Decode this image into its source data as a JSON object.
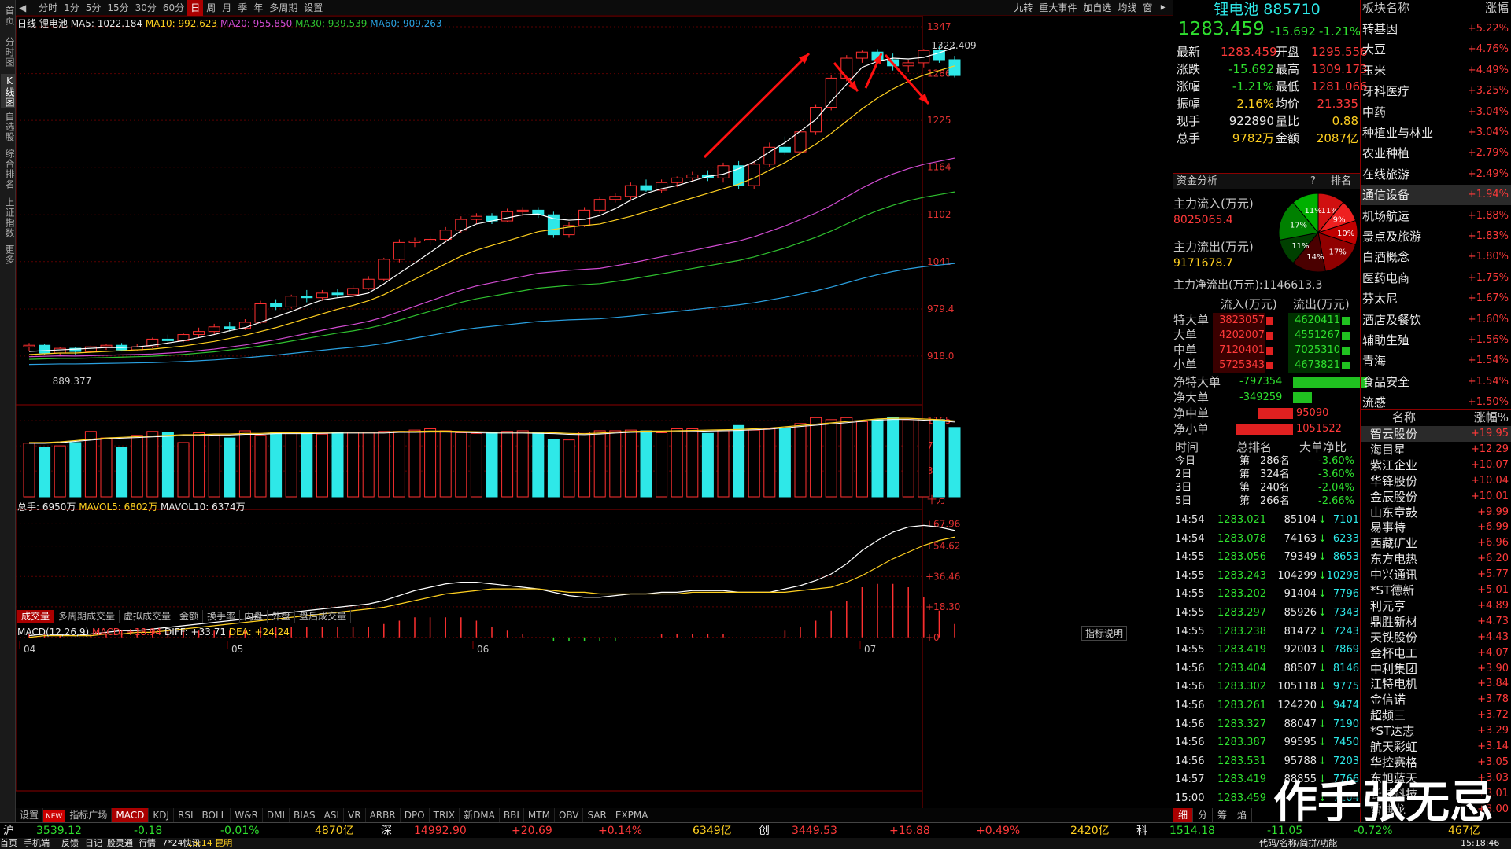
{
  "leftnav": [
    "首页",
    "分时图",
    "K线图",
    "自选股",
    "综合排名",
    "上证指数",
    "更多"
  ],
  "topbar": {
    "periods": [
      "分时",
      "1分",
      "5分",
      "15分",
      "30分",
      "60分",
      "日",
      "周",
      "月",
      "季",
      "年",
      "多周期",
      "设置"
    ],
    "active": "日",
    "right": [
      "九转",
      "重大事件",
      "加自选",
      "均线",
      "窗",
      "⯈"
    ]
  },
  "kline": {
    "label": "日线",
    "name": "锂电池",
    "ma5": "MA5: 1022.184",
    "ma10": "MA10: 992.623",
    "ma20": "MA20: 955.850",
    "ma30": "MA30: 939.539",
    "ma60": "MA60: 909.263",
    "hi_label": "1322.409",
    "lo_label": "889.377",
    "yticks": [
      "1347",
      "1286",
      "1225",
      "1164",
      "1102",
      "1041",
      "979.4",
      "918.0"
    ]
  },
  "volume": {
    "label": "总手: 6950万",
    "mavol5": "MAVOL5: 6802万",
    "mavol10": "MAVOL10: 6374万",
    "yticks": [
      "1165",
      "780",
      "395",
      "十万"
    ],
    "tabs": [
      "成交量",
      "多周期成交量",
      "虚拟成交量",
      "金额",
      "换手率",
      "内盘",
      "外盘",
      "盘后成交量"
    ]
  },
  "macd": {
    "label": "MACD(12,26,9)",
    "macd": "MACD: +18.94",
    "diff": "DIFF: +33.71",
    "dea": "DEA: +24.24",
    "btn": "指标说明",
    "yticks": [
      "+67.96",
      "+54.62",
      "+36.46",
      "+18.30",
      "+0"
    ]
  },
  "xaxis": [
    "04",
    "05",
    "06",
    "07"
  ],
  "bottomtabs": [
    "设置",
    "NEW",
    "指标广场",
    "MACD",
    "KDJ",
    "RSI",
    "BOLL",
    "W&R",
    "DMI",
    "BIAS",
    "ASI",
    "VR",
    "ARBR",
    "DPO",
    "TRIX",
    "新DMA",
    "BBI",
    "MTM",
    "OBV",
    "SAR",
    "EXPMA"
  ],
  "quote": {
    "title": "锂电池 885710",
    "price": "1283.459",
    "chg": "-15.692",
    "pct": "-1.21%",
    "rows": [
      [
        "最新",
        "1283.459",
        "开盘",
        "1295.556"
      ],
      [
        "涨跌",
        "-15.692",
        "最高",
        "1309.173"
      ],
      [
        "涨幅",
        "-1.21%",
        "最低",
        "1281.066"
      ],
      [
        "振幅",
        "2.16%",
        "均价",
        "21.335"
      ],
      [
        "现手",
        "922890",
        "量比",
        "0.88"
      ],
      [
        "总手",
        "9782万",
        "金额",
        "2087亿"
      ]
    ]
  },
  "fund": {
    "title": "资金分析",
    "q": "?",
    "rank": "排名",
    "in_label": "主力流入(万元)",
    "in_val": "8025065.4",
    "out_label": "主力流出(万元)",
    "out_val": "9171678.7",
    "net": "主力净流出(万元):1146613.3",
    "pie": [
      "11%",
      "9%",
      "10%",
      "17%",
      "14%",
      "11%",
      "17%",
      "11%"
    ],
    "head": [
      "流入(万元)",
      "流出(万元)"
    ],
    "rows": [
      [
        "特大单",
        "3823057",
        "4620411"
      ],
      [
        "大单",
        "4202007",
        "4551267"
      ],
      [
        "中单",
        "7120401",
        "7025310"
      ],
      [
        "小单",
        "5725343",
        "4673821"
      ]
    ],
    "net_rows": [
      [
        "净特大单",
        "-797354"
      ],
      [
        "净大单",
        "-349259"
      ],
      [
        "净中单",
        "95090"
      ],
      [
        "净小单",
        "1051522"
      ]
    ]
  },
  "rankt": {
    "head": [
      "时间",
      "总排名",
      "大单净比"
    ],
    "rows": [
      [
        "今日",
        "第",
        "286名",
        "-3.60%"
      ],
      [
        "2日",
        "第",
        "324名",
        "-3.60%"
      ],
      [
        "3日",
        "第",
        "240名",
        "-2.04%"
      ],
      [
        "5日",
        "第",
        "266名",
        "-2.66%"
      ]
    ]
  },
  "ticks": [
    [
      "14:54",
      "1283.021",
      "85104",
      "7101"
    ],
    [
      "14:54",
      "1283.078",
      "74163",
      "6233"
    ],
    [
      "14:55",
      "1283.056",
      "79349",
      "8653"
    ],
    [
      "14:55",
      "1283.243",
      "104299",
      "10298"
    ],
    [
      "14:55",
      "1283.202",
      "91404",
      "7796"
    ],
    [
      "14:55",
      "1283.297",
      "85926",
      "7343"
    ],
    [
      "14:55",
      "1283.238",
      "81472",
      "7243"
    ],
    [
      "14:55",
      "1283.419",
      "92003",
      "7869"
    ],
    [
      "14:56",
      "1283.404",
      "88507",
      "8146"
    ],
    [
      "14:56",
      "1283.302",
      "105118",
      "9775"
    ],
    [
      "14:56",
      "1283.261",
      "124220",
      "9474"
    ],
    [
      "14:56",
      "1283.327",
      "88047",
      "7190"
    ],
    [
      "14:56",
      "1283.387",
      "99595",
      "7450"
    ],
    [
      "14:56",
      "1283.531",
      "95788",
      "7203"
    ],
    [
      "14:57",
      "1283.419",
      "88855",
      "7766"
    ],
    [
      "15:00",
      "1283.459",
      "",
      "7104"
    ]
  ],
  "tickTabs": [
    "细",
    "分",
    "筹",
    "焰"
  ],
  "sectors": {
    "head": [
      "板块名称",
      "涨幅"
    ],
    "rows": [
      [
        "转基因",
        "+5.22%"
      ],
      [
        "大豆",
        "+4.76%"
      ],
      [
        "玉米",
        "+4.49%"
      ],
      [
        "牙科医疗",
        "+3.25%"
      ],
      [
        "中药",
        "+3.04%"
      ],
      [
        "种植业与林业",
        "+3.04%"
      ],
      [
        "农业种植",
        "+2.79%"
      ],
      [
        "在线旅游",
        "+2.49%"
      ],
      [
        "通信设备",
        "+1.94%"
      ],
      [
        "机场航运",
        "+1.88%"
      ],
      [
        "景点及旅游",
        "+1.83%"
      ],
      [
        "白酒概念",
        "+1.80%"
      ],
      [
        "医药电商",
        "+1.75%"
      ],
      [
        "芬太尼",
        "+1.67%"
      ],
      [
        "酒店及餐饮",
        "+1.60%"
      ],
      [
        "辅助生殖",
        "+1.56%"
      ],
      [
        "青海",
        "+1.54%"
      ],
      [
        "食品安全",
        "+1.54%"
      ],
      [
        "流感",
        "+1.50%"
      ]
    ]
  },
  "stocks": {
    "head": [
      "名称",
      "涨幅%"
    ],
    "rows": [
      [
        "智云股份",
        "+19.95"
      ],
      [
        "海目星",
        "+12.29"
      ],
      [
        "紫江企业",
        "+10.07"
      ],
      [
        "华锋股份",
        "+10.04"
      ],
      [
        "金辰股份",
        "+10.01"
      ],
      [
        "山东章鼓",
        "+9.99"
      ],
      [
        "易事特",
        "+6.99"
      ],
      [
        "西藏矿业",
        "+6.96"
      ],
      [
        "东方电热",
        "+6.20"
      ],
      [
        "中兴通讯",
        "+5.77"
      ],
      [
        "*ST德新",
        "+5.01"
      ],
      [
        "利元亨",
        "+4.89"
      ],
      [
        "鼎胜新材",
        "+4.73"
      ],
      [
        "天铁股份",
        "+4.43"
      ],
      [
        "金杯电工",
        "+4.07"
      ],
      [
        "中利集团",
        "+3.90"
      ],
      [
        "江特电机",
        "+3.84"
      ],
      [
        "金信诺",
        "+3.78"
      ],
      [
        "超频三",
        "+3.72"
      ],
      [
        "*ST达志",
        "+3.29"
      ],
      [
        "航天彩虹",
        "+3.14"
      ],
      [
        "华控赛格",
        "+3.05"
      ],
      [
        "东旭蓝天",
        "+3.03"
      ],
      [
        "长城科技",
        "+3.01"
      ],
      [
        "雪迪龙",
        "+3.00"
      ]
    ]
  },
  "status": {
    "sh": [
      "沪",
      "3539.12",
      "-0.18",
      "-0.01%",
      "4870亿"
    ],
    "sz": [
      "深",
      "14992.90",
      "+20.69",
      "+0.14%",
      "6349亿"
    ],
    "cy": [
      "创",
      "3449.53",
      "+16.88",
      "+0.49%",
      "2420亿"
    ],
    "kc": [
      "科",
      "1514.18",
      "-11.05",
      "-0.72%",
      "467亿"
    ]
  },
  "status2": [
    "首页",
    "手机端",
    "反馈",
    "日记",
    "股灵通",
    "行情",
    "7*24快讯",
    "15:14 昆明",
    "代码/名称/简拼/功能",
    "15:18:46"
  ],
  "watermark": "作手张无忌",
  "colors": {
    "up": "#ff3030",
    "down": "#2ee8e8",
    "ma5": "#ffffff",
    "ma10": "#ffd020",
    "ma20": "#d24cd2",
    "ma30": "#2fc02f",
    "ma60": "#2aa0e0"
  },
  "chart_data": [
    {
      "type": "candlestick",
      "title": "锂电池 日线",
      "ylim": [
        889.377,
        1347
      ],
      "candles": [
        [
          930,
          935,
          925,
          932
        ],
        [
          932,
          934,
          920,
          922
        ],
        [
          922,
          930,
          918,
          928
        ],
        [
          928,
          930,
          920,
          924
        ],
        [
          924,
          932,
          922,
          930
        ],
        [
          930,
          934,
          926,
          932
        ],
        [
          932,
          935,
          924,
          926
        ],
        [
          926,
          934,
          925,
          930
        ],
        [
          930,
          942,
          928,
          940
        ],
        [
          940,
          946,
          934,
          938
        ],
        [
          938,
          948,
          936,
          946
        ],
        [
          946,
          955,
          942,
          950
        ],
        [
          950,
          960,
          946,
          956
        ],
        [
          956,
          962,
          950,
          954
        ],
        [
          954,
          966,
          952,
          962
        ],
        [
          962,
          990,
          960,
          986
        ],
        [
          986,
          992,
          978,
          982
        ],
        [
          982,
          998,
          980,
          996
        ],
        [
          996,
          1004,
          988,
          994
        ],
        [
          994,
          1004,
          990,
          1000
        ],
        [
          1000,
          1006,
          994,
          998
        ],
        [
          998,
          1010,
          994,
          1006
        ],
        [
          1006,
          1022,
          1004,
          1018
        ],
        [
          1018,
          1046,
          1016,
          1044
        ],
        [
          1044,
          1070,
          1040,
          1066
        ],
        [
          1066,
          1072,
          1060,
          1068
        ],
        [
          1068,
          1074,
          1062,
          1070
        ],
        [
          1070,
          1086,
          1066,
          1082
        ],
        [
          1082,
          1100,
          1078,
          1096
        ],
        [
          1096,
          1104,
          1090,
          1100
        ],
        [
          1100,
          1104,
          1090,
          1094
        ],
        [
          1094,
          1110,
          1092,
          1106
        ],
        [
          1106,
          1112,
          1100,
          1108
        ],
        [
          1108,
          1112,
          1098,
          1102
        ],
        [
          1102,
          1106,
          1072,
          1076
        ],
        [
          1076,
          1092,
          1072,
          1088
        ],
        [
          1088,
          1112,
          1086,
          1108
        ],
        [
          1108,
          1126,
          1104,
          1122
        ],
        [
          1122,
          1130,
          1118,
          1126
        ],
        [
          1126,
          1144,
          1122,
          1140
        ],
        [
          1140,
          1148,
          1132,
          1134
        ],
        [
          1134,
          1148,
          1130,
          1144
        ],
        [
          1144,
          1152,
          1138,
          1150
        ],
        [
          1150,
          1158,
          1146,
          1154
        ],
        [
          1154,
          1160,
          1146,
          1150
        ],
        [
          1150,
          1170,
          1144,
          1166
        ],
        [
          1166,
          1172,
          1136,
          1140
        ],
        [
          1140,
          1172,
          1136,
          1168
        ],
        [
          1168,
          1196,
          1164,
          1190
        ],
        [
          1190,
          1204,
          1180,
          1184
        ],
        [
          1184,
          1212,
          1182,
          1210
        ],
        [
          1210,
          1246,
          1206,
          1242
        ],
        [
          1242,
          1284,
          1238,
          1280
        ],
        [
          1280,
          1310,
          1276,
          1306
        ],
        [
          1306,
          1316,
          1300,
          1314
        ],
        [
          1314,
          1318,
          1300,
          1304
        ],
        [
          1304,
          1312,
          1290,
          1296
        ],
        [
          1296,
          1304,
          1288,
          1300
        ],
        [
          1300,
          1318,
          1294,
          1316
        ],
        [
          1316,
          1322.409,
          1300,
          1304
        ],
        [
          1304,
          1309,
          1281,
          1283.459
        ]
      ],
      "ma_lines": {
        "MA5": [
          924,
          925,
          926,
          927,
          928,
          929,
          929,
          930,
          932,
          935,
          938,
          942,
          946,
          951,
          955,
          962,
          969,
          976,
          984,
          991,
          994,
          996,
          1000,
          1012,
          1026,
          1039,
          1053,
          1067,
          1081,
          1090,
          1094,
          1098,
          1102,
          1103,
          1097,
          1095,
          1096,
          1101,
          1110,
          1121,
          1130,
          1136,
          1140,
          1146,
          1152,
          1155,
          1162,
          1171,
          1184,
          1196,
          1211,
          1226,
          1250,
          1272,
          1294,
          1302,
          1306,
          1305,
          1307,
          1313,
          1320
        ],
        "MA10": [
          920,
          921,
          922,
          922,
          923,
          924,
          925,
          926,
          927,
          929,
          931,
          934,
          937,
          941,
          945,
          950,
          955,
          961,
          967,
          973,
          979,
          984,
          990,
          998,
          1008,
          1018,
          1028,
          1038,
          1048,
          1056,
          1062,
          1068,
          1074,
          1080,
          1083,
          1086,
          1088,
          1090,
          1095,
          1100,
          1106,
          1112,
          1118,
          1124,
          1130,
          1136,
          1142,
          1150,
          1160,
          1170,
          1182,
          1194,
          1208,
          1224,
          1240,
          1254,
          1266,
          1276,
          1284,
          1290,
          1296
        ]
      },
      "note": "red arrows drawn as annotations"
    },
    {
      "type": "bar",
      "title": "成交量",
      "unit": "十万",
      "ylim": [
        0,
        1165
      ],
      "values": [
        820,
        760,
        780,
        830,
        1000,
        900,
        760,
        940,
        1000,
        980,
        830,
        980,
        940,
        900,
        1010,
        940,
        990,
        980,
        990,
        960,
        990,
        990,
        990,
        1000,
        1000,
        1020,
        1040,
        1010,
        980,
        970,
        980,
        1000,
        1010,
        990,
        880,
        870,
        990,
        1010,
        1010,
        1020,
        1010,
        980,
        1040,
        1040,
        970,
        1010,
        1090,
        1020,
        1040,
        1050,
        1120,
        1210,
        1180,
        1210,
        1150,
        1180,
        1220,
        1180,
        1190,
        1180,
        1060
      ],
      "mavol5": [
        830,
        830,
        840,
        860,
        880,
        900,
        910,
        920,
        930,
        940,
        950,
        950,
        960,
        960,
        970,
        970,
        980,
        980,
        980,
        985,
        990,
        990,
        990,
        990,
        1000,
        1000,
        1005,
        1005,
        1000,
        995,
        990,
        990,
        990,
        985,
        980,
        970,
        965,
        975,
        990,
        1000,
        1005,
        1005,
        1010,
        1015,
        1020,
        1025,
        1030,
        1040,
        1050,
        1070,
        1090,
        1110,
        1130,
        1150,
        1170,
        1190,
        1200,
        1200,
        1190,
        1180,
        1160
      ]
    },
    {
      "type": "line",
      "title": "MACD(12,26,9)",
      "ylim": [
        -5,
        67.96
      ],
      "diff": [
        1,
        2,
        1.5,
        1,
        2,
        3,
        4,
        4,
        5,
        6,
        7,
        8,
        9,
        10,
        11,
        13,
        14,
        15,
        16,
        17,
        18,
        19,
        20,
        22,
        25,
        28,
        30,
        32,
        33,
        33,
        32,
        31,
        30,
        29,
        27,
        25,
        24,
        24,
        25,
        26,
        26,
        27,
        27,
        28,
        28,
        28,
        27,
        27,
        27,
        29,
        31,
        34,
        38,
        44,
        52,
        58,
        63,
        66,
        67,
        66,
        64
      ],
      "dea": [
        0,
        1,
        1,
        1,
        1,
        2,
        2,
        3,
        3,
        4,
        5,
        6,
        7,
        8,
        9,
        10,
        11,
        12,
        13,
        14,
        15,
        16,
        17,
        18,
        20,
        22,
        24,
        26,
        27,
        28,
        29,
        29,
        29,
        29,
        28,
        27,
        27,
        26,
        26,
        26,
        26,
        26,
        26,
        27,
        27,
        27,
        27,
        27,
        27,
        27,
        28,
        29,
        30,
        33,
        37,
        42,
        47,
        51,
        55,
        58,
        60
      ]
    }
  ]
}
